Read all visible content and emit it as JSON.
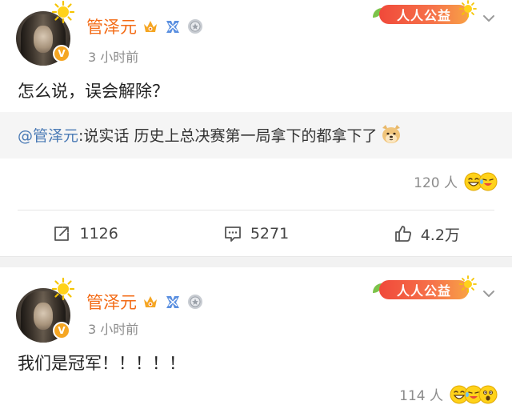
{
  "posts": [
    {
      "username": "管泽元",
      "time": "3 小时前",
      "charity_label": "人人公益",
      "text": "怎么说，误会解除？",
      "repost": {
        "mention": "@管泽元",
        "text": ":说实话 历史上总决赛第一局拿下的都拿下了"
      },
      "likes": "120 人",
      "actions": {
        "repost": "1126",
        "comment": "5271",
        "like": "4.2万"
      }
    },
    {
      "username": "管泽元",
      "time": "3 小时前",
      "charity_label": "人人公益",
      "text": "我们是冠军！！！！！",
      "likes": "114 人"
    }
  ],
  "icons": {
    "verified_badge": "V",
    "accent_color": "#f36b16",
    "mention_color": "#4a7ab5",
    "charity_colors": [
      "#f0493a",
      "#f8a246"
    ]
  }
}
